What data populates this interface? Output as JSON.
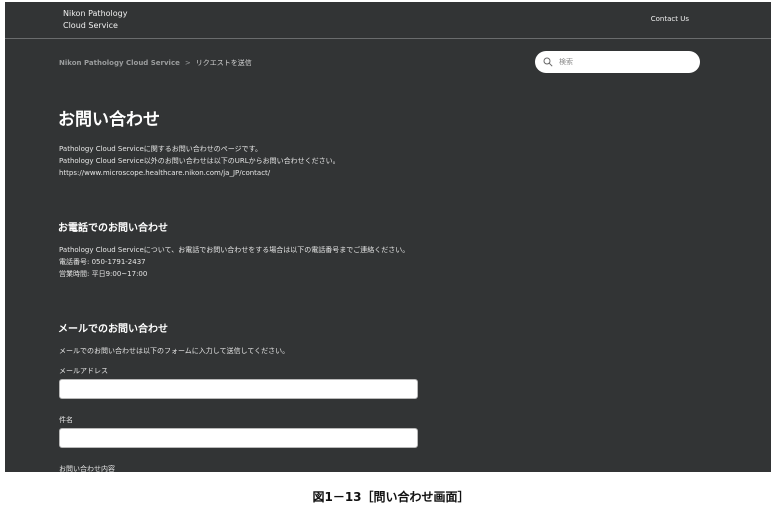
{
  "header": {
    "brand_line1": "Nikon Pathology",
    "brand_line2": "Cloud Service",
    "contact_link": "Contact Us"
  },
  "breadcrumb": {
    "home": "Nikon Pathology Cloud Service",
    "separator": ">",
    "current": "リクエストを送信"
  },
  "search": {
    "placeholder": "検索",
    "icon": "search-icon"
  },
  "page": {
    "title": "お問い合わせ",
    "intro_line1": "Pathology Cloud Serviceに関するお問い合わせのページです。",
    "intro_line2": "Pathology Cloud Service以外のお問い合わせは以下のURLからお問い合わせください。",
    "intro_line3": "https://www.microscope.healthcare.nikon.com/ja_JP/contact/"
  },
  "phone_section": {
    "heading": "お電話でのお問い合わせ",
    "line1": "Pathology Cloud Serviceについて、お電話でお問い合わせをする場合は以下の電話番号までご連絡ください。",
    "line2": "電話番号: 050-1791-2437",
    "line3": "営業時間: 平日9:00~17:00"
  },
  "mail_section": {
    "heading": "メールでのお問い合わせ",
    "description": "メールでのお問い合わせは以下のフォームに入力して送信してください。",
    "email_label": "メールアドレス",
    "email_value": "",
    "subject_label": "件名",
    "subject_value": "",
    "body_label": "お問い合わせ内容"
  },
  "caption": "図1－13［問い合わせ画面］",
  "colors": {
    "background": "#323435",
    "text": "#e9e9e9",
    "input": "#ffffff"
  }
}
